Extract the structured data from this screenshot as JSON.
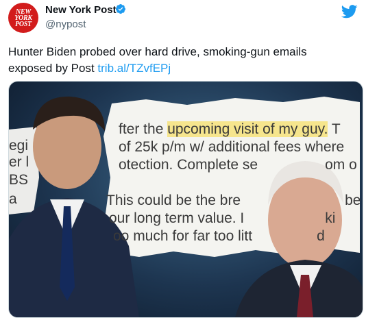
{
  "account": {
    "display_name": "New York Post",
    "handle": "@nypost",
    "avatar_lines": [
      "NEW",
      "YORK",
      "POST"
    ]
  },
  "tweet": {
    "text": "Hunter Biden probed over hard drive, smoking-gun emails exposed by Post ",
    "link": "trib.al/TZvfEPj"
  },
  "media": {
    "document_lines": [
      {
        "pre": "fter the ",
        "highlight": "upcoming visit of my guy.",
        "post": " T"
      },
      {
        "pre": "of 25k p/m w/ additional fees where",
        "highlight": "",
        "post": ""
      },
      {
        "pre": "otection. Complete se",
        "highlight": "",
        "post": "om o"
      },
      {
        "pre": "This could be the bre",
        "highlight": "",
        "post": "be"
      },
      {
        "pre": "our long term value. I",
        "highlight": "",
        "post": "ki"
      },
      {
        "pre": "oo much for far too litt",
        "highlight": "",
        "post": "d"
      }
    ],
    "left_fragments": [
      "egi",
      "er l",
      "BS",
      "a"
    ]
  },
  "colors": {
    "brand_red": "#d21c1c",
    "twitter_blue": "#1d9bf0",
    "highlight": "#f6e58d"
  },
  "icons": {
    "verified": "verified-badge-icon",
    "logo": "twitter-bird-icon"
  }
}
